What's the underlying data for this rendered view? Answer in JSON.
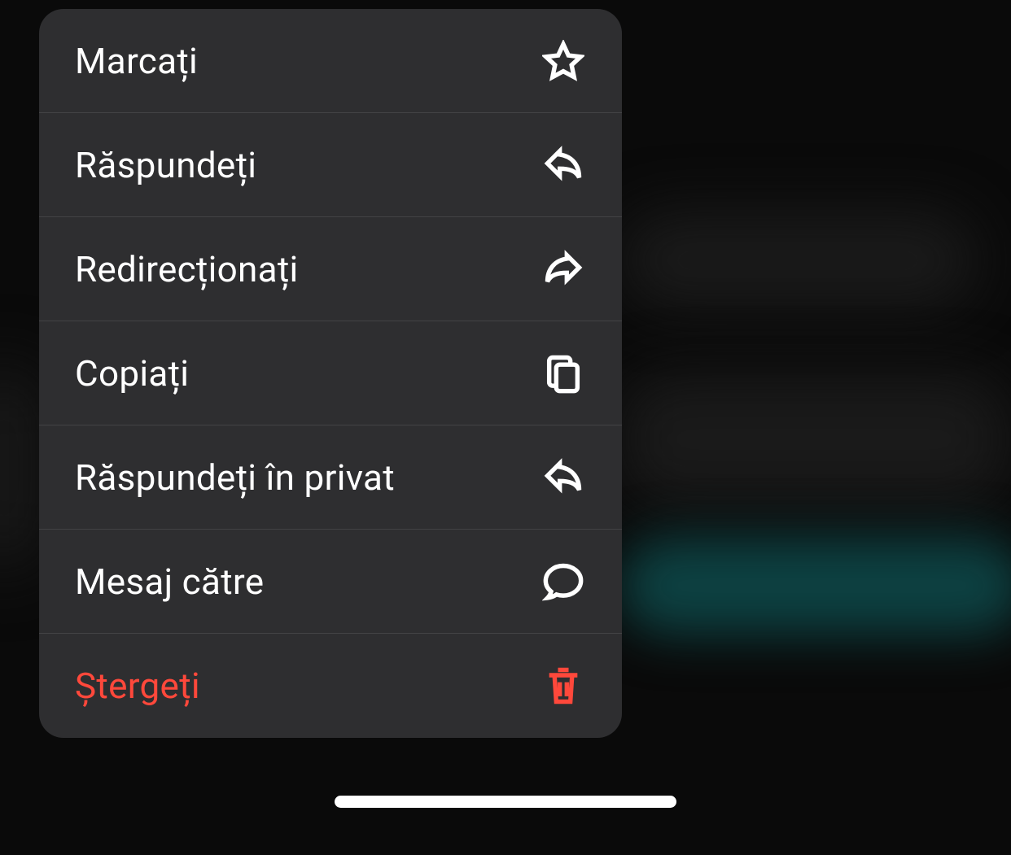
{
  "menu": {
    "items": [
      {
        "label": "Marcați",
        "icon": "star-icon",
        "destructive": false
      },
      {
        "label": "Răspundeți",
        "icon": "reply-icon",
        "destructive": false
      },
      {
        "label": "Redirecționați",
        "icon": "forward-icon",
        "destructive": false
      },
      {
        "label": "Copiați",
        "icon": "copy-icon",
        "destructive": false
      },
      {
        "label": "Răspundeți în privat",
        "icon": "reply-icon",
        "destructive": false
      },
      {
        "label": "Mesaj către",
        "icon": "chat-icon",
        "destructive": false
      },
      {
        "label": "Ștergeți",
        "icon": "trash-icon",
        "destructive": true
      }
    ]
  }
}
